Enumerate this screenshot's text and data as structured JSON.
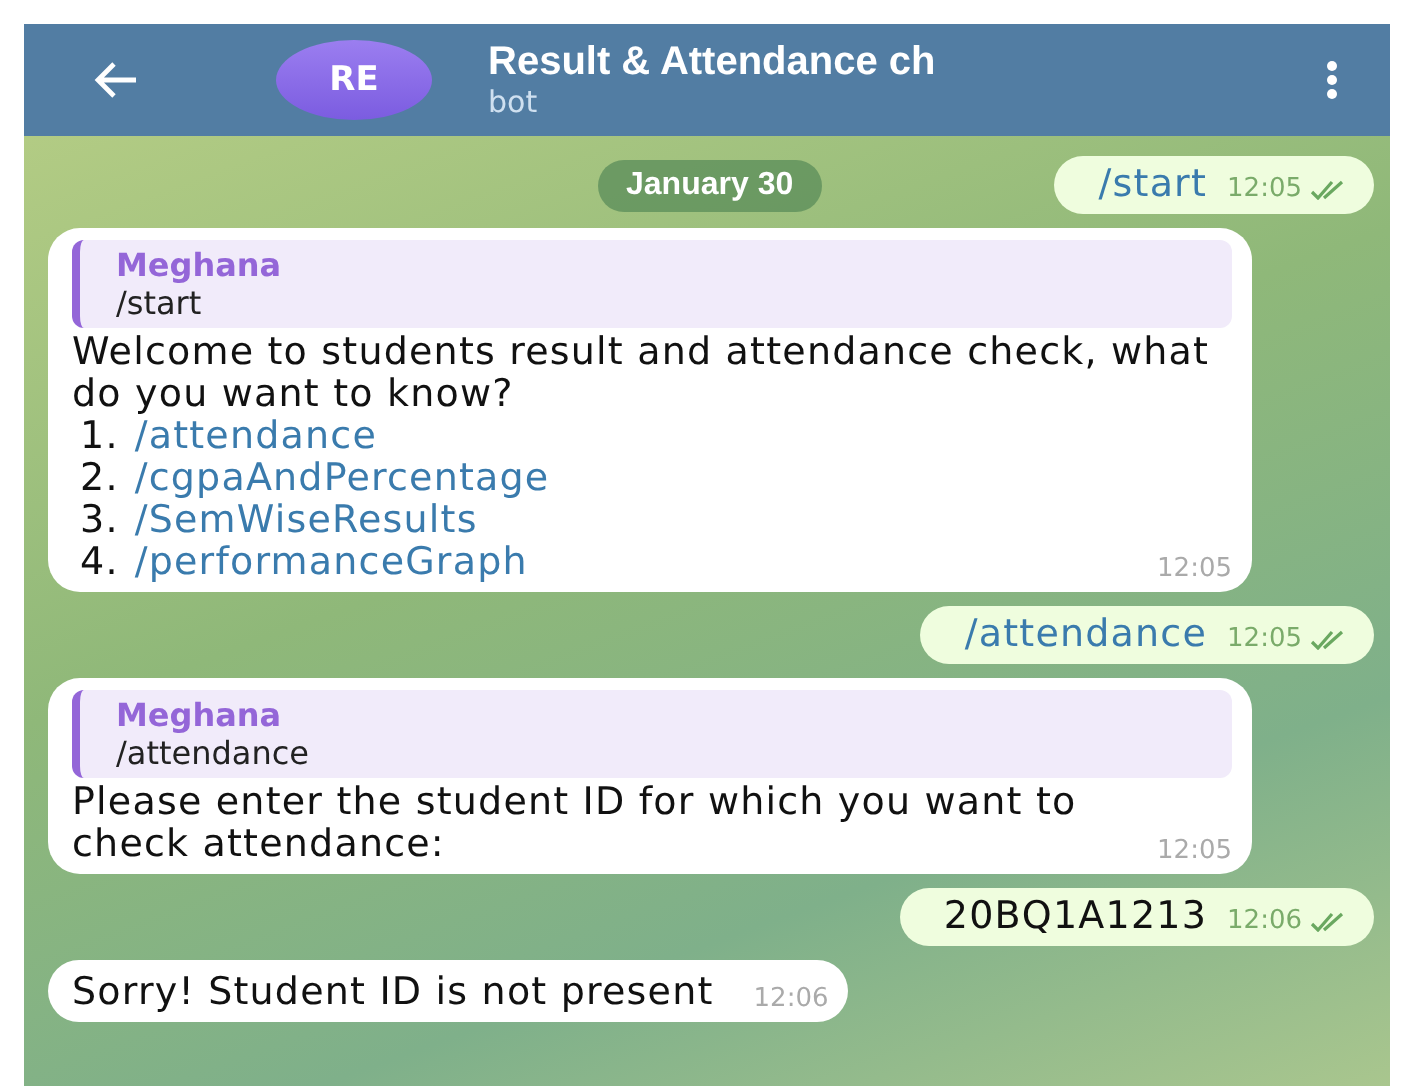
{
  "header": {
    "avatar": "RE",
    "title": "Result & Attendance ch",
    "subtitle": "bot"
  },
  "date": "January 30",
  "messages": [
    {
      "kind": "outgoing",
      "text": "/start",
      "command": true,
      "time": "12:05",
      "read": true
    },
    {
      "kind": "incoming",
      "reply": {
        "author": "Meghana",
        "text": "/start"
      },
      "text": "Welcome to students result and attendance check, what do you want to know?",
      "list": [
        {
          "number": "1.",
          "command": "/attendance"
        },
        {
          "number": "2.",
          "command": "/cgpaAndPercentage"
        },
        {
          "number": "3.",
          "command": "/SemWiseResults"
        },
        {
          "number": "4.",
          "command": "/performanceGraph"
        }
      ],
      "time": "12:05"
    },
    {
      "kind": "outgoing",
      "text": "/attendance",
      "command": true,
      "time": "12:05",
      "read": true
    },
    {
      "kind": "incoming",
      "reply": {
        "author": "Meghana",
        "text": "/attendance"
      },
      "text": "Please enter the student ID for which you want to check attendance:",
      "time": "12:05"
    },
    {
      "kind": "outgoing",
      "text": "20BQ1A1213",
      "command": false,
      "time": "12:06",
      "read": true
    },
    {
      "kind": "incoming",
      "text": "Sorry! Student ID is not present",
      "time": "12:06"
    }
  ]
}
